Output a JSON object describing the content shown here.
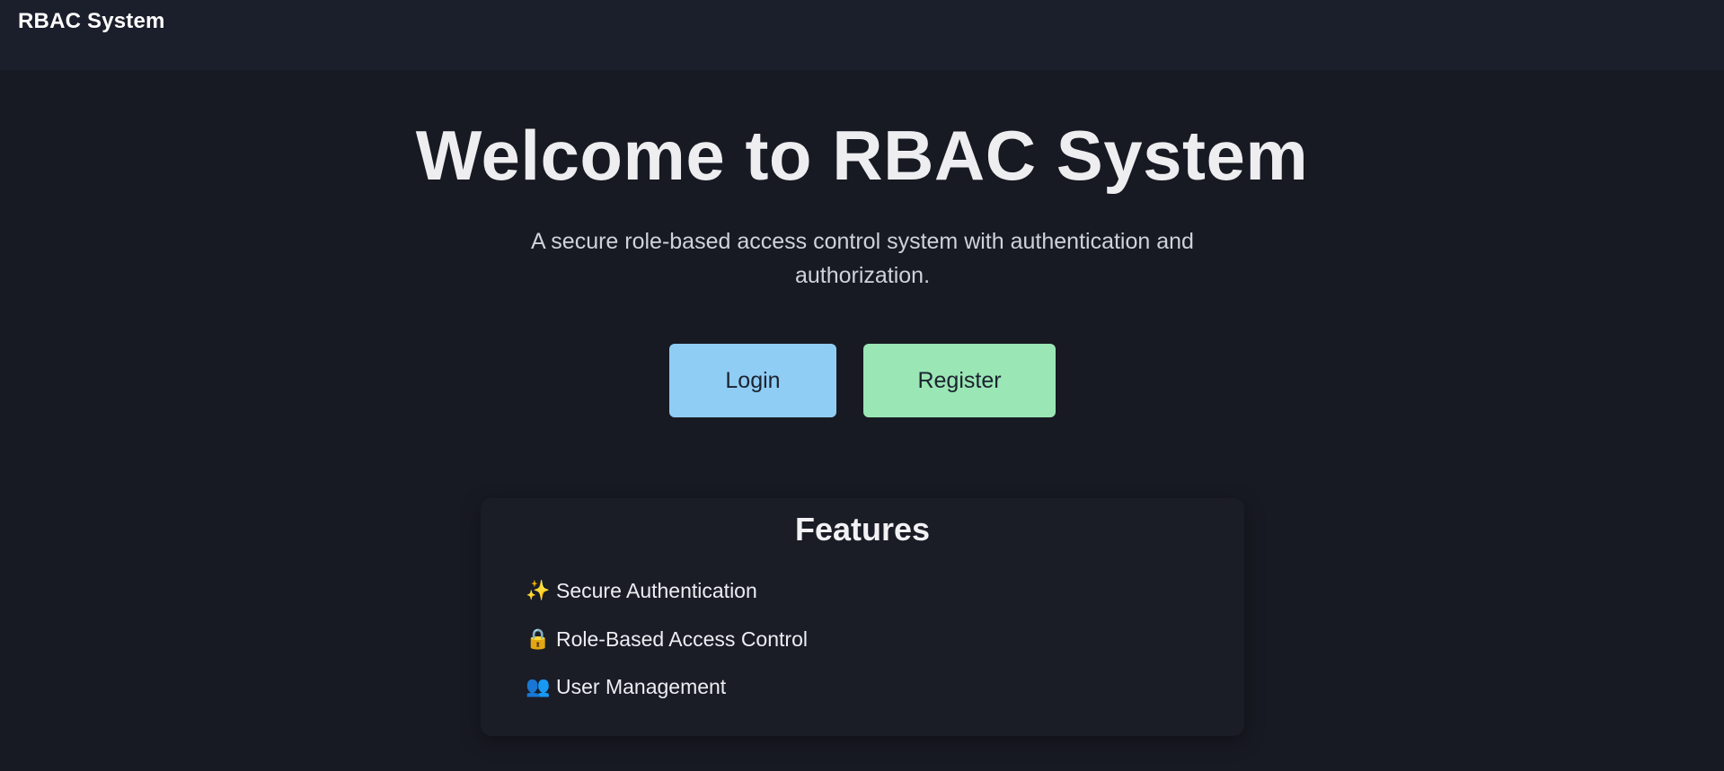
{
  "navbar": {
    "brand": "RBAC System"
  },
  "hero": {
    "title": "Welcome to RBAC System",
    "subtitle": "A secure role-based access control system with authentication and authorization."
  },
  "actions": {
    "login_label": "Login",
    "register_label": "Register",
    "login_color": "#90cdf4",
    "register_color": "#9ae6b4"
  },
  "features": {
    "title": "Features",
    "items": [
      {
        "icon": "sparkles-icon",
        "glyph": "✨",
        "label": "Secure Authentication"
      },
      {
        "icon": "lock-icon",
        "glyph": "🔒",
        "label": "Role-Based Access Control"
      },
      {
        "icon": "users-icon",
        "glyph": "👥",
        "label": "User Management"
      }
    ]
  },
  "colors": {
    "background": "#181a23",
    "navbar": "#1b1f2b"
  }
}
